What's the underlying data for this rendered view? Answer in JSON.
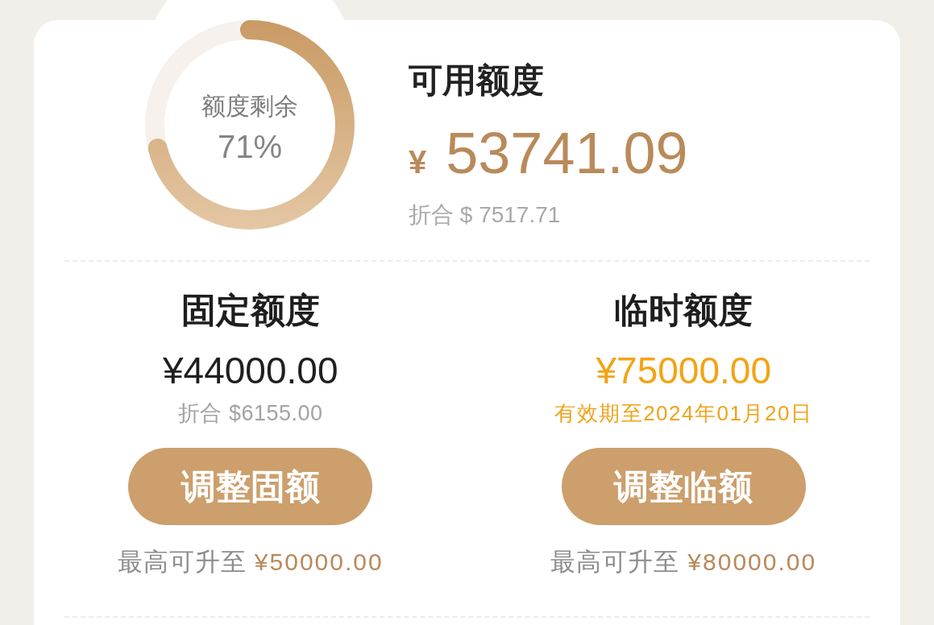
{
  "ring": {
    "label": "额度剩余",
    "percent": "71%",
    "level": 0.71
  },
  "available": {
    "title": "可用额度",
    "currency": "¥",
    "amount": "53741.09",
    "converted": "折合 $ 7517.71"
  },
  "quotas": [
    {
      "kind": "fixed",
      "title": "固定额度",
      "amount": "¥44000.00",
      "note": "折合 $6155.00",
      "button": "调整固额",
      "limit_label": "最高可升至",
      "limit_amount": "¥50000.00"
    },
    {
      "kind": "temporary",
      "title": "临时额度",
      "amount": "¥75000.00",
      "note": "有效期至2024年01月20日",
      "button": "调整临额",
      "limit_label": "最高可升至",
      "limit_amount": "¥80000.00"
    }
  ]
}
